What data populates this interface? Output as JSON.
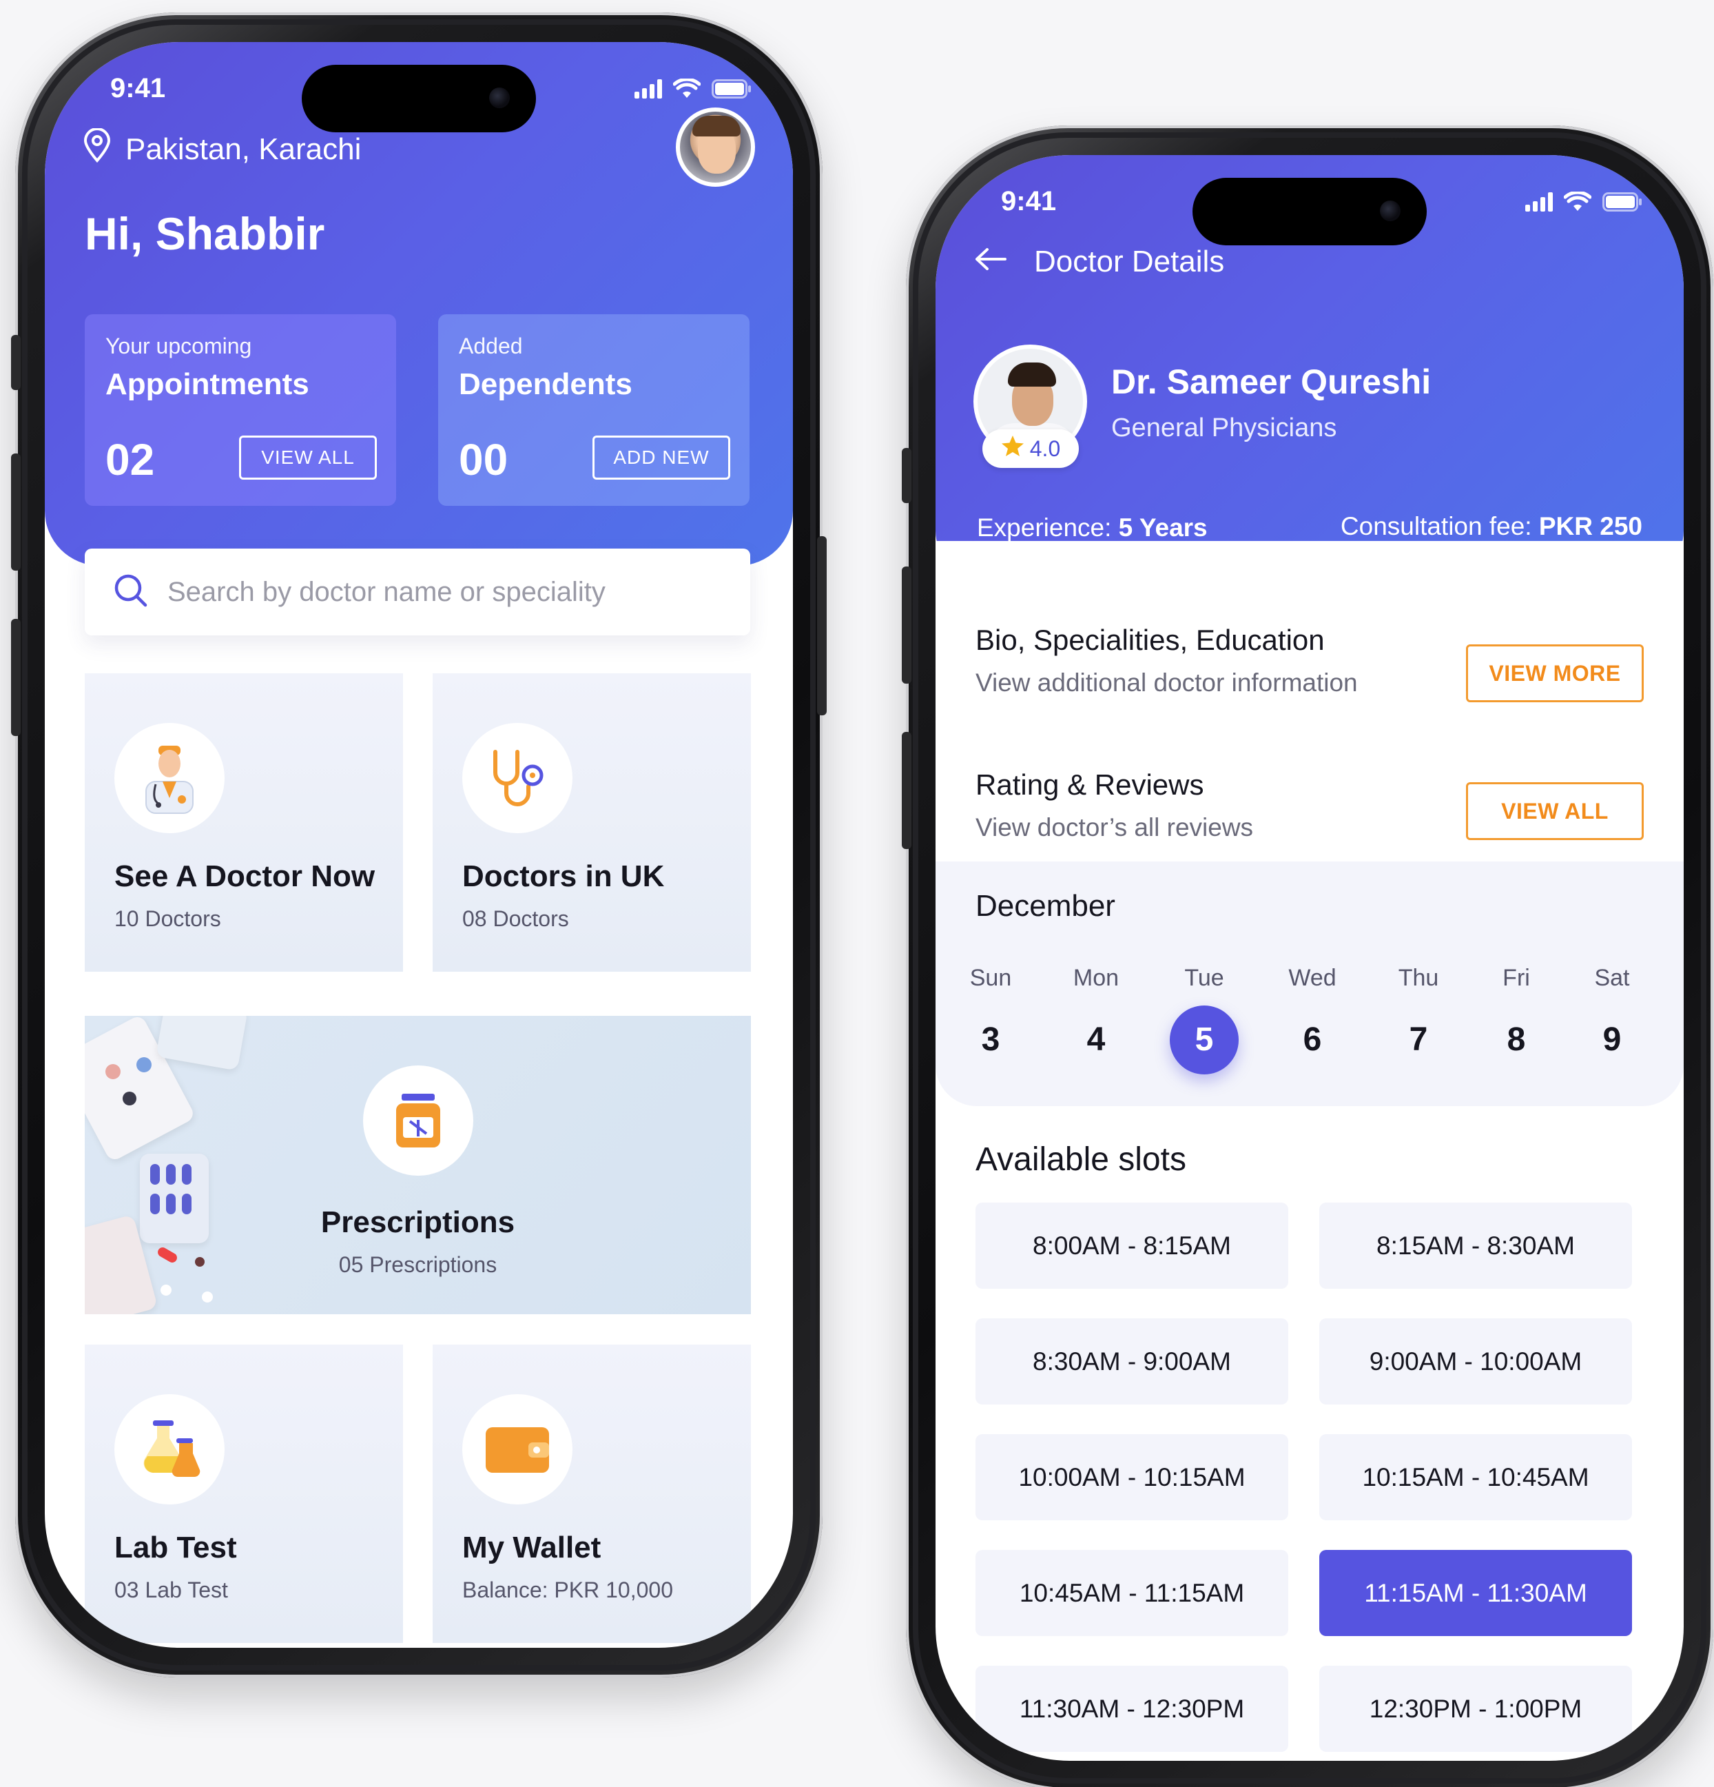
{
  "status": {
    "time": "9:41"
  },
  "home": {
    "location": "Pakistan, Karachi",
    "greeting": "Hi, Shabbir",
    "appointments": {
      "caption": "Your upcoming",
      "title": "Appointments",
      "count": "02",
      "button": "VIEW ALL"
    },
    "dependents": {
      "caption": "Added",
      "title": "Dependents",
      "count": "00",
      "button": "ADD NEW"
    },
    "search": {
      "placeholder": "Search by doctor name or speciality"
    },
    "tiles": [
      {
        "title": "See A Doctor Now",
        "subtitle": "10 Doctors",
        "icon": "doctor-icon"
      },
      {
        "title": "Doctors in UK",
        "subtitle": "08 Doctors",
        "icon": "stethoscope-icon"
      },
      {
        "title": "Prescriptions",
        "subtitle": "05 Prescriptions",
        "icon": "medicine-bottle-icon"
      },
      {
        "title": "Lab Test",
        "subtitle": "03 Lab Test",
        "icon": "lab-flask-icon"
      },
      {
        "title": "My Wallet",
        "subtitle": "Balance: PKR 10,000",
        "icon": "wallet-icon"
      }
    ]
  },
  "details": {
    "page_title": "Doctor Details",
    "doctor": {
      "name": "Dr. Sameer Qureshi",
      "specialty": "General Physicians",
      "rating": "4.0",
      "experience_label": "Experience:",
      "experience_value": "5 Years",
      "fee_label": "Consultation fee:",
      "fee_value": "PKR 250"
    },
    "bio": {
      "title": "Bio, Specialities, Education",
      "desc": "View additional doctor information",
      "button": "VIEW MORE"
    },
    "reviews": {
      "title": "Rating & Reviews",
      "desc": "View doctor’s all reviews",
      "button": "VIEW ALL"
    },
    "calendar": {
      "month": "December",
      "days": [
        {
          "name": "Sun",
          "date": "3"
        },
        {
          "name": "Mon",
          "date": "4"
        },
        {
          "name": "Tue",
          "date": "5"
        },
        {
          "name": "Wed",
          "date": "6"
        },
        {
          "name": "Thu",
          "date": "7"
        },
        {
          "name": "Fri",
          "date": "8"
        },
        {
          "name": "Sat",
          "date": "9"
        }
      ],
      "selected_date": "5"
    },
    "slots_title": "Available slots",
    "slots": [
      "8:00AM - 8:15AM",
      "8:15AM - 8:30AM",
      "8:30AM - 9:00AM",
      "9:00AM - 10:00AM",
      "10:00AM - 10:15AM",
      "10:15AM - 10:45AM",
      "10:45AM - 11:15AM",
      "11:15AM - 11:30AM",
      "11:30AM - 12:30PM",
      "12:30PM - 1:00PM"
    ],
    "selected_slot": "11:15AM - 11:30AM"
  },
  "colors": {
    "primary": "#5654E0",
    "hero_gradient_start": "#5A4FD9",
    "hero_gradient_end": "#4F74EA",
    "accent_orange": "#F28B1B",
    "tile_bg": "#EEF1F9"
  }
}
